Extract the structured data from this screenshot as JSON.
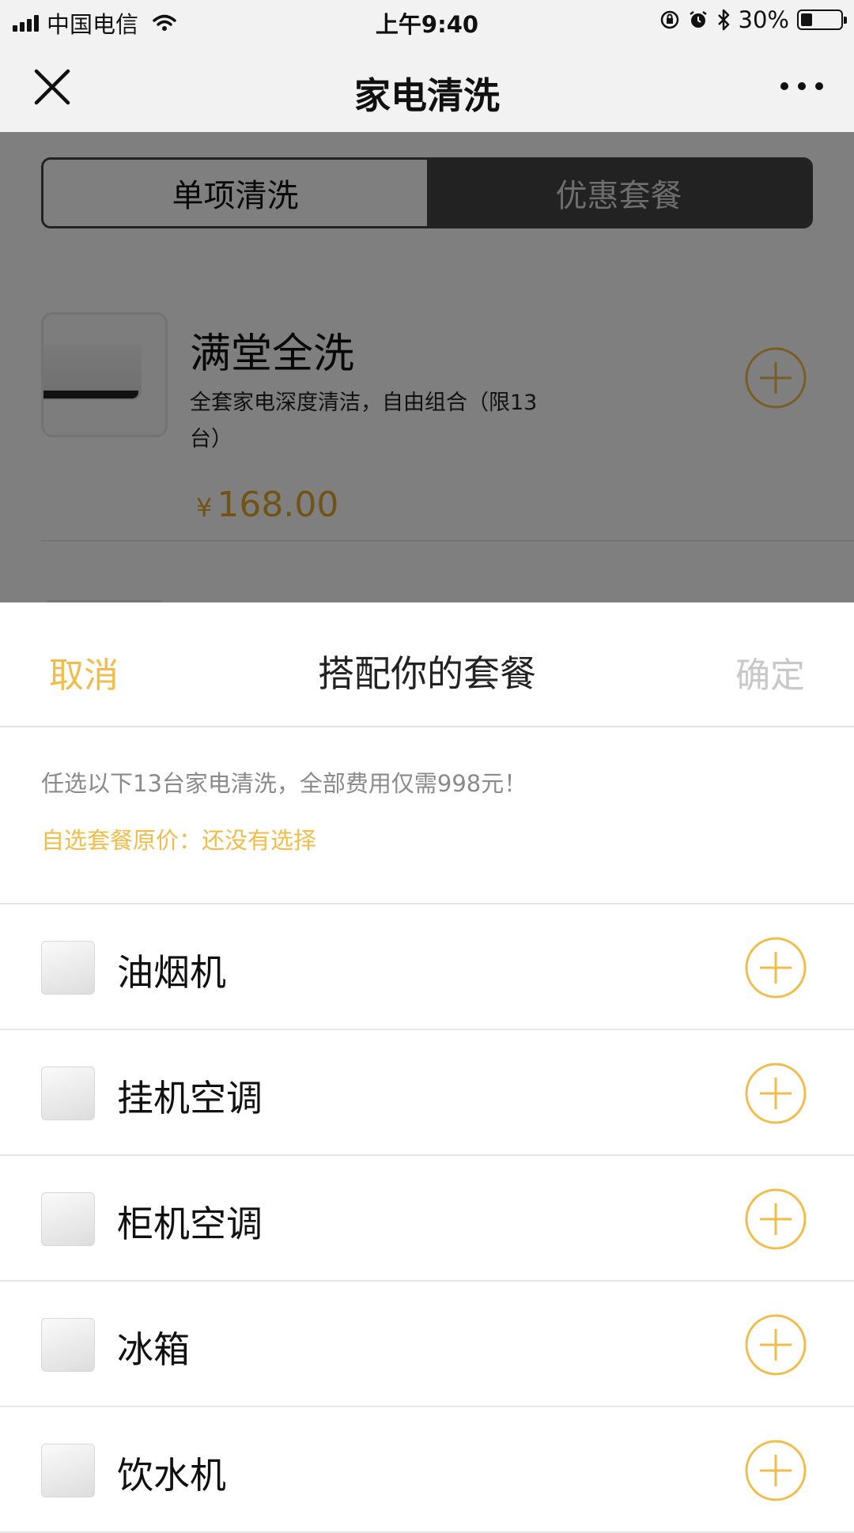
{
  "status_bar": {
    "carrier": "中国电信",
    "time": "上午9:40",
    "battery_text": "30%",
    "battery_level": 0.3
  },
  "nav": {
    "title": "家电清洗",
    "close_icon": "close-icon",
    "more_icon": "more-icon"
  },
  "page": {
    "tabs": [
      {
        "label": "单项清洗",
        "active": true
      },
      {
        "label": "优惠套餐",
        "active": false
      }
    ],
    "product": {
      "name": "满堂全洗",
      "description": "全套家电深度清洁，自由组合（限13台）",
      "currency": "¥",
      "price": "168.00"
    }
  },
  "sheet": {
    "cancel_label": "取消",
    "title": "搭配你的套餐",
    "confirm_label": "确定",
    "info_text": "任选以下13台家电清洗，全部费用仅需998元！",
    "original_price_text": "自选套餐原价：还没有选择",
    "items": [
      {
        "label": "油烟机"
      },
      {
        "label": "挂机空调"
      },
      {
        "label": "柜机空调"
      },
      {
        "label": "冰箱"
      },
      {
        "label": "饮水机"
      }
    ]
  },
  "colors": {
    "accent": "#f0bd4a",
    "price": "#e2a92a",
    "disabled": "#c8c8c8",
    "overlay": "rgba(0,0,0,0.5)"
  }
}
